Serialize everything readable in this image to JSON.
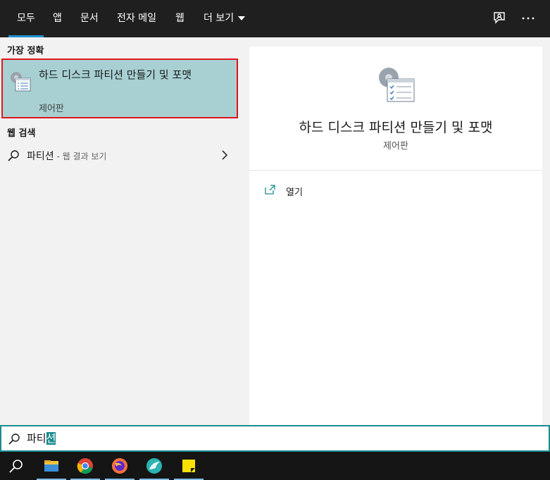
{
  "tabs": [
    {
      "label": "모두",
      "active": true
    },
    {
      "label": "앱"
    },
    {
      "label": "문서"
    },
    {
      "label": "전자 메일"
    },
    {
      "label": "웹"
    },
    {
      "label": "더 보기"
    }
  ],
  "top_icons": [
    "feedback-icon",
    "more-options-icon"
  ],
  "best_match": {
    "heading": "가장 정확",
    "title": "하드 디스크 파티션 만들기 및 포맷",
    "subtitle": "제어판",
    "icon": "control-panel-icon"
  },
  "web_search": {
    "heading": "웹 검색",
    "query": "파티션",
    "hint": " - 웹 결과 보기"
  },
  "detail": {
    "title": "하드 디스크 파티션 만들기 및 포맷",
    "subtitle": "제어판",
    "actions": [
      {
        "label": "열기",
        "icon": "open-icon"
      }
    ]
  },
  "search": {
    "text_prefix": "파티",
    "text_selected": "션"
  },
  "taskbar": {
    "items": [
      "search-icon",
      "file-explorer-icon",
      "chrome-icon",
      "firefox-icon",
      "app-icon",
      "sticky-notes-icon"
    ]
  },
  "colors": {
    "accent": "#1a8c8e",
    "highlight_border": "#e0141b",
    "selected_bg": "#a8d0d3",
    "tab_underline": "#1f8fce"
  }
}
